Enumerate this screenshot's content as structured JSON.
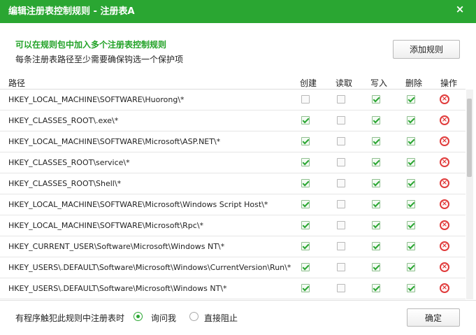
{
  "dialog": {
    "title": "编辑注册表控制规则 - 注册表A",
    "close_symbol": "×"
  },
  "intro": {
    "headline": "可以在规则包中加入多个注册表控制规则",
    "description": "每条注册表路径至少需要确保钩选一个保护项"
  },
  "buttons": {
    "add_rule": "添加规则",
    "confirm": "确定"
  },
  "table": {
    "headers": {
      "path": "路径",
      "create": "创建",
      "read": "读取",
      "write": "写入",
      "delete": "删除",
      "action": "操作"
    },
    "rows": [
      {
        "path": "HKEY_LOCAL_MACHINE\\SOFTWARE\\Huorong\\*",
        "create": false,
        "read": false,
        "write": true,
        "delete": true
      },
      {
        "path": "HKEY_CLASSES_ROOT\\.exe\\*",
        "create": true,
        "read": false,
        "write": true,
        "delete": true
      },
      {
        "path": "HKEY_LOCAL_MACHINE\\SOFTWARE\\Microsoft\\ASP.NET\\*",
        "create": true,
        "read": false,
        "write": true,
        "delete": true
      },
      {
        "path": "HKEY_CLASSES_ROOT\\service\\*",
        "create": true,
        "read": false,
        "write": true,
        "delete": true
      },
      {
        "path": "HKEY_CLASSES_ROOT\\Shell\\*",
        "create": true,
        "read": false,
        "write": true,
        "delete": true
      },
      {
        "path": "HKEY_LOCAL_MACHINE\\SOFTWARE\\Microsoft\\Windows Script Host\\*",
        "create": true,
        "read": false,
        "write": true,
        "delete": true
      },
      {
        "path": "HKEY_LOCAL_MACHINE\\SOFTWARE\\Microsoft\\Rpc\\*",
        "create": true,
        "read": false,
        "write": true,
        "delete": true
      },
      {
        "path": "HKEY_CURRENT_USER\\Software\\Microsoft\\Windows NT\\*",
        "create": true,
        "read": false,
        "write": true,
        "delete": true
      },
      {
        "path": "HKEY_USERS\\.DEFAULT\\Software\\Microsoft\\Windows\\CurrentVersion\\Run\\*",
        "create": true,
        "read": false,
        "write": true,
        "delete": true
      },
      {
        "path": "HKEY_USERS\\.DEFAULT\\Software\\Microsoft\\Windows NT\\*",
        "create": true,
        "read": false,
        "write": true,
        "delete": true
      }
    ]
  },
  "footer": {
    "trigger_text": "有程序触犯此规则中注册表时",
    "options": [
      {
        "label": "询问我",
        "selected": true
      },
      {
        "label": "直接阻止",
        "selected": false
      }
    ]
  },
  "colors": {
    "accent": "#2aa632",
    "delete": "#e03a3a"
  },
  "icons": {
    "close": "close-icon",
    "delete": "delete-circle-icon",
    "check": "check-icon"
  }
}
